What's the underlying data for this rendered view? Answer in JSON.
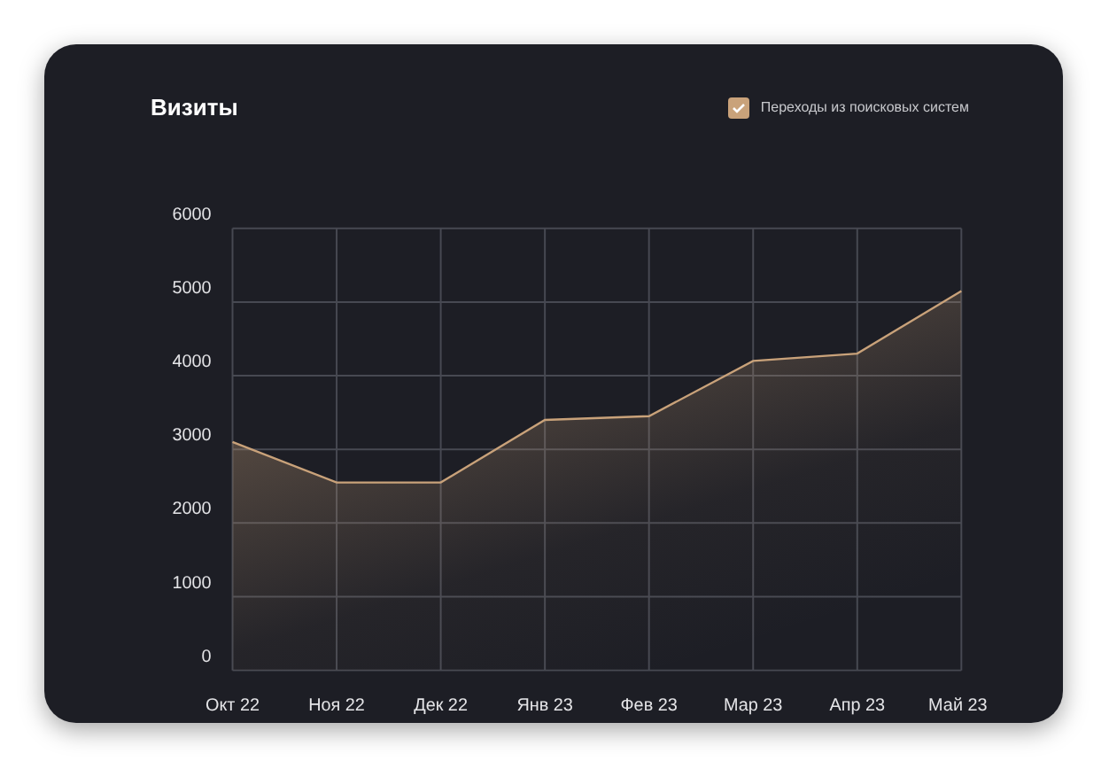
{
  "card": {
    "title": "Визиты",
    "legend": {
      "checked": true
    },
    "chart_data": {
      "type": "area",
      "grid": true,
      "categories": [
        "Окт 22",
        "Ноя 22",
        "Дек 22",
        "Янв 23",
        "Фев 23",
        "Мар 23",
        "Апр 23",
        "Май 23"
      ],
      "ylim": [
        0,
        6000
      ],
      "yticks": [
        0,
        1000,
        2000,
        3000,
        4000,
        5000,
        6000
      ],
      "series": [
        {
          "name": "Переходы из поисковых систем",
          "color": "#c9a27a",
          "values": [
            3100,
            2550,
            2550,
            3400,
            3450,
            4200,
            4300,
            5150
          ]
        }
      ]
    }
  }
}
